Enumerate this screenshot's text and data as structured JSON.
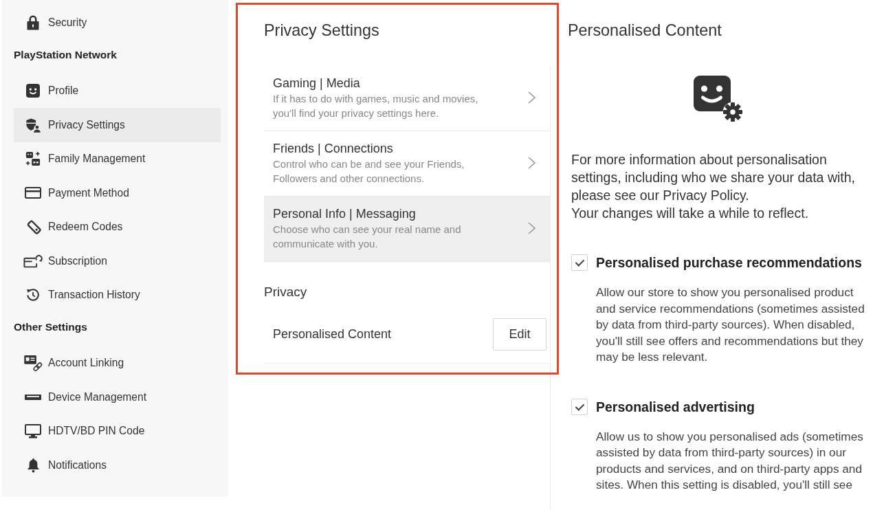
{
  "sidebar": {
    "groups": [
      {
        "items": [
          {
            "label": "Security",
            "selected": false
          }
        ]
      },
      {
        "heading": "PlayStation Network",
        "items": [
          {
            "label": "Profile",
            "selected": false
          },
          {
            "label": "Privacy Settings",
            "selected": true
          },
          {
            "label": "Family Management",
            "selected": false
          },
          {
            "label": "Payment Method",
            "selected": false
          },
          {
            "label": "Redeem Codes",
            "selected": false
          },
          {
            "label": "Subscription",
            "selected": false
          },
          {
            "label": "Transaction History",
            "selected": false
          }
        ]
      },
      {
        "heading": "Other Settings",
        "items": [
          {
            "label": "Account Linking",
            "selected": false
          },
          {
            "label": "Device Management",
            "selected": false
          },
          {
            "label": "HDTV/BD PIN Code",
            "selected": false
          },
          {
            "label": "Notifications",
            "selected": false
          }
        ]
      }
    ]
  },
  "settings_panel": {
    "highlighted": true,
    "title": "Privacy Settings",
    "categories": [
      {
        "title": "Gaming | Media",
        "description": "If it has to do with games, music and movies, you'll find your privacy settings here.",
        "selected": false
      },
      {
        "title": "Friends | Connections",
        "description": "Control who can be and see your Friends, Followers and other connections.",
        "selected": false
      },
      {
        "title": "Personal Info | Messaging",
        "description": "Choose who can see your real name and communicate with you.",
        "selected": true
      }
    ],
    "sections": [
      {
        "heading": "Privacy",
        "rows": [
          {
            "label": "Personalised Content",
            "button": "Edit"
          }
        ]
      }
    ]
  },
  "detail_panel": {
    "title": "Personalised Content",
    "info": [
      "For more information about personalisation settings, including who we share your data with, please see our Privacy Policy.",
      "Your changes will take a while to reflect."
    ],
    "options": [
      {
        "label": "Personalised purchase recommendations",
        "checked": true,
        "description": "Allow our store to show you personalised product and service recommendations (sometimes assisted by data from third-party sources). When disabled, you'll still see offers and recommendations but they may be less relevant."
      },
      {
        "label": "Personalised advertising",
        "checked": true,
        "description": "Allow us to show you personalised ads (sometimes assisted by data from third-party sources) in our products and services, and on third-party apps and sites. When this setting is disabled, you'll still see"
      }
    ]
  }
}
